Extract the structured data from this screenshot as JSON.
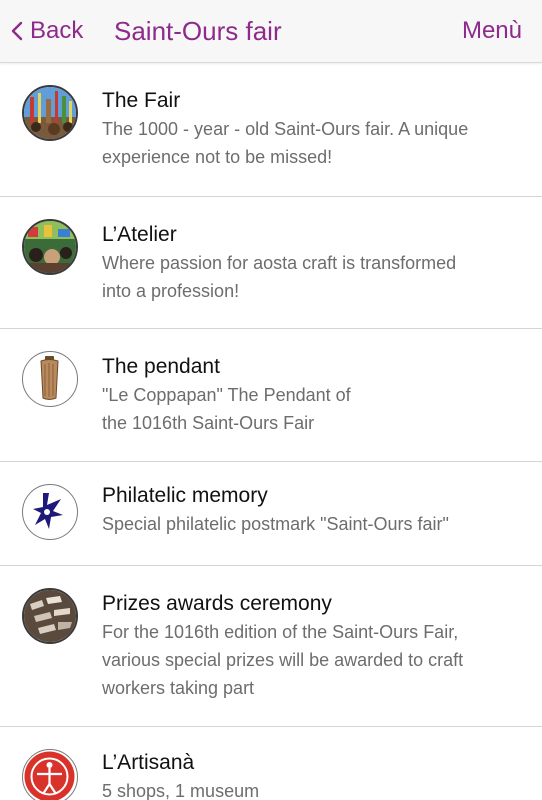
{
  "header": {
    "back_label": "Back",
    "title": "Saint-Ours fair",
    "menu_label": "Menù",
    "accent_color": "#8e2a8b"
  },
  "items": [
    {
      "title": "The Fair",
      "lines": [
        "The 1000 - year - old Saint-Ours fair. A unique",
        "experience not to be missed!"
      ],
      "icon": "fair-photo-thumbnail"
    },
    {
      "title": "L’Atelier",
      "lines": [
        "Where passion for aosta craft is transformed",
        "into a profession!"
      ],
      "icon": "atelier-photo-thumbnail"
    },
    {
      "title": "The pendant",
      "lines": [
        "\"Le Coppapan\" The Pendant of",
        "the 1016th Saint-Ours Fair"
      ],
      "icon": "pendant-thumbnail"
    },
    {
      "title": "Philatelic memory",
      "lines": [
        "Special philatelic postmark \"Saint-Ours fair\""
      ],
      "icon": "postmark-thumbnail"
    },
    {
      "title": "Prizes awards ceremony",
      "lines": [
        "For the 1016th edition of the Saint-Ours Fair,",
        "various special prizes will be awarded to craft",
        "workers taking part"
      ],
      "icon": "prizes-photo-thumbnail"
    },
    {
      "title": "L’Artisanà",
      "lines": [
        "5 shops, 1 museum"
      ],
      "icon": "artisana-logo-thumbnail"
    }
  ]
}
